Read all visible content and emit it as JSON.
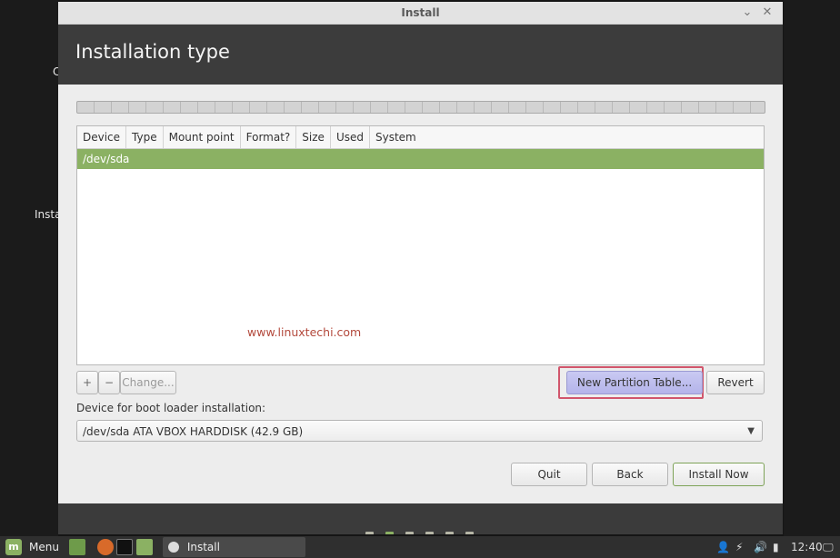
{
  "desktop": {
    "left_text_1": "C",
    "left_text_2": "Insta"
  },
  "window": {
    "title": "Install",
    "minimize_symbol": "⌄",
    "close_symbol": "✕"
  },
  "header": {
    "title": "Installation type"
  },
  "table": {
    "columns": [
      "Device",
      "Type",
      "Mount point",
      "Format?",
      "Size",
      "Used",
      "System"
    ],
    "rows": [
      {
        "device": "/dev/sda"
      }
    ]
  },
  "watermark": "www.linuxtechi.com",
  "actions": {
    "add_label": "+",
    "remove_label": "−",
    "change_label": "Change...",
    "new_partition_table_label": "New Partition Table...",
    "revert_label": "Revert"
  },
  "bootloader": {
    "label": "Device for boot loader installation:",
    "selected": "/dev/sda ATA VBOX HARDDISK (42.9 GB)"
  },
  "buttons": {
    "quit": "Quit",
    "back": "Back",
    "install_now": "Install Now"
  },
  "progress": {
    "steps_total": 6,
    "current_step": 1
  },
  "taskbar": {
    "menu_label": "Menu",
    "task_label": "Install",
    "clock": "12:40"
  },
  "colors": {
    "accent": "#8bb163",
    "header_bg": "#3c3c3c",
    "highlight_border": "#d1566c",
    "watermark": "#b3493c"
  },
  "icons": {
    "mint": "mint-logo-icon",
    "files": "file-manager-icon",
    "firefox": "firefox-icon",
    "terminal": "terminal-icon",
    "folder": "folder-icon",
    "user": "user-icon",
    "network": "network-icon",
    "volume": "volume-icon",
    "battery": "battery-icon",
    "display": "display-icon"
  }
}
